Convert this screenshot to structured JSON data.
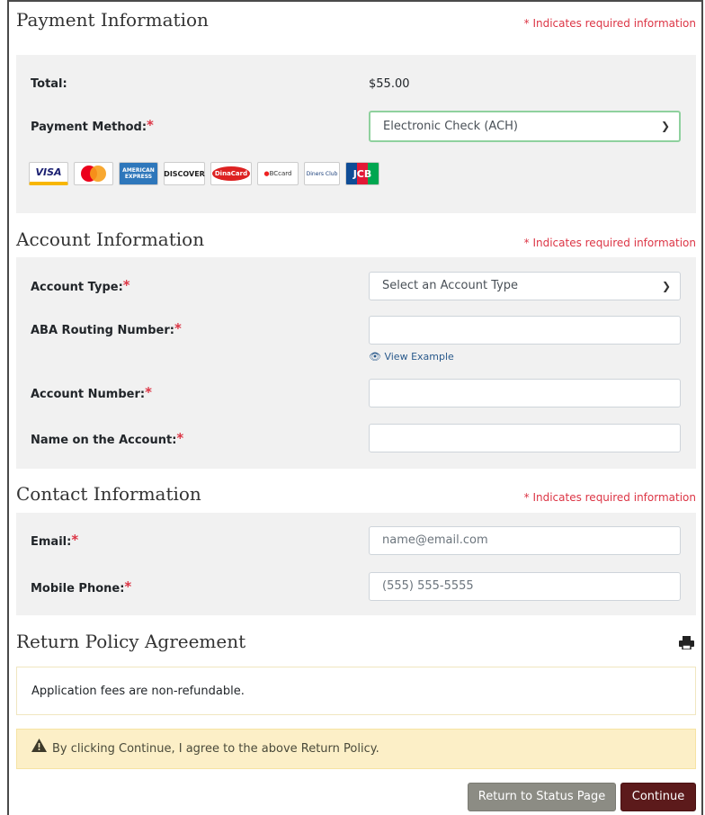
{
  "required_note": "* Indicates required information",
  "payment": {
    "title": "Payment Information",
    "total_label": "Total:",
    "total_value": "$55.00",
    "method_label": "Payment Method:",
    "method_value": "Electronic Check (ACH)",
    "cards": [
      "VISA",
      "mastercard",
      "AMERICAN EXPRESS",
      "DISCOVER",
      "DinaCard",
      "BCcard",
      "Diners Club",
      "JCB"
    ]
  },
  "account": {
    "title": "Account Information",
    "type_label": "Account Type:",
    "type_value": "Select an Account Type",
    "routing_label": "ABA Routing Number:",
    "view_example": "View Example",
    "number_label": "Account Number:",
    "name_label": "Name on the Account:"
  },
  "contact": {
    "title": "Contact Information",
    "email_label": "Email:",
    "email_placeholder": "name@email.com",
    "phone_label": "Mobile Phone:",
    "phone_placeholder": "(555) 555-5555"
  },
  "policy": {
    "title": "Return Policy Agreement",
    "text": "Application fees are non-refundable.",
    "warning": "By clicking Continue, I agree to the above Return Policy."
  },
  "buttons": {
    "return_label": "Return to Status Page",
    "continue_label": "Continue"
  },
  "colors": {
    "required": "#dc3545",
    "continue_bg": "#5c1a1b",
    "return_bg": "#8c8c84",
    "warning_bg": "#fcefc7",
    "focus_border": "#8fd19e"
  }
}
